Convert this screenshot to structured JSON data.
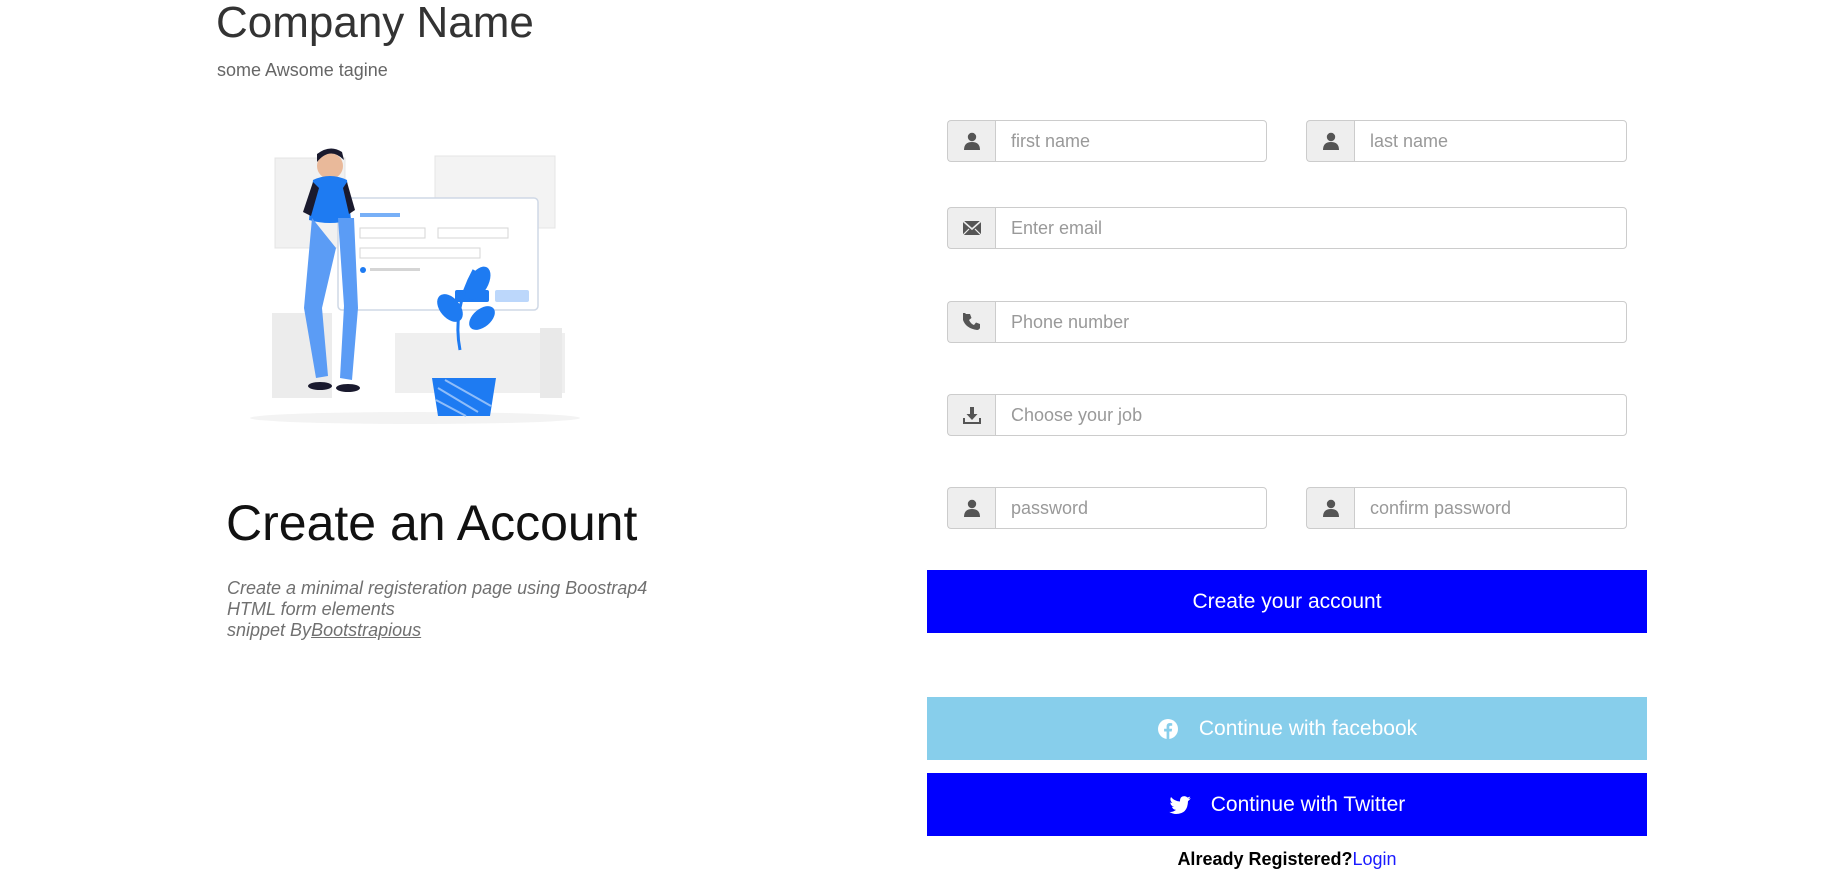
{
  "header": {
    "company_name": "Company Name",
    "tagline": "some Awsome tagine"
  },
  "illustration": {
    "icon": "person-with-form-illustration",
    "accent_color": "#1e7bf2"
  },
  "intro": {
    "title": "Create an Account",
    "line1": "Create a minimal registeration page using Boostrap4",
    "line2": "HTML form elements",
    "line3_prefix": "snippet By",
    "line3_link": "Bootstrapious"
  },
  "form": {
    "first_name": {
      "placeholder": "first name",
      "icon": "user-icon"
    },
    "last_name": {
      "placeholder": "last name",
      "icon": "user-icon"
    },
    "email": {
      "placeholder": "Enter email",
      "icon": "envelope-icon"
    },
    "phone": {
      "placeholder": "Phone number",
      "icon": "phone-icon"
    },
    "job": {
      "placeholder": "Choose your job",
      "icon": "download-icon"
    },
    "password": {
      "placeholder": "password",
      "icon": "user-icon"
    },
    "confirm_password": {
      "placeholder": "confirm password",
      "icon": "user-icon"
    }
  },
  "buttons": {
    "create": "Create your account",
    "facebook": "Continue with facebook",
    "twitter": "Continue with Twitter"
  },
  "login": {
    "prompt": "Already Registered?",
    "link": "Login"
  },
  "colors": {
    "primary_button": "#0000ff",
    "facebook_button": "#87ceeb",
    "link": "#1a1aff"
  }
}
